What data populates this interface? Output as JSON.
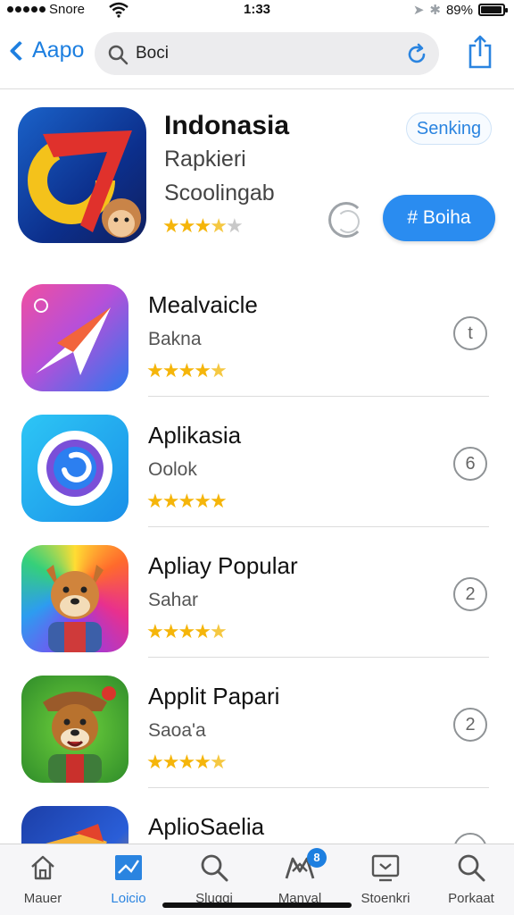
{
  "status_bar": {
    "carrier": "Snore",
    "time": "1:33",
    "battery": "89%",
    "battery_level": 0.89
  },
  "nav": {
    "back_label": "Aapo",
    "search_query": "Boci"
  },
  "featured": {
    "title": "Indonasia",
    "subtitle": "Rapkieri",
    "subtitle2": "Scoolingab",
    "badge": "Senking",
    "action": "# Boiha",
    "rating": 3.5
  },
  "apps": [
    {
      "name": "Mealvaicle",
      "sub": "Bakna",
      "rating": 4.5,
      "action": "t"
    },
    {
      "name": "Aplikasia",
      "sub": "Oolok",
      "rating": 5,
      "action": "6"
    },
    {
      "name": "Apliay Popular",
      "sub": "Sahar",
      "rating": 4.5,
      "action": "2"
    },
    {
      "name": "Applit Papari",
      "sub": "Saoa'a",
      "rating": 4.5,
      "action": "2"
    },
    {
      "name": "AplioSaelia"
    }
  ],
  "tabs": [
    {
      "label": "Mauer"
    },
    {
      "label": "Loicio"
    },
    {
      "label": "Sluggi"
    },
    {
      "label": "Manval",
      "badge": "8"
    },
    {
      "label": "Stoenkri"
    },
    {
      "label": "Porkaat"
    }
  ],
  "colors": {
    "accent": "#2a84e0",
    "star": "#f5b50a"
  }
}
